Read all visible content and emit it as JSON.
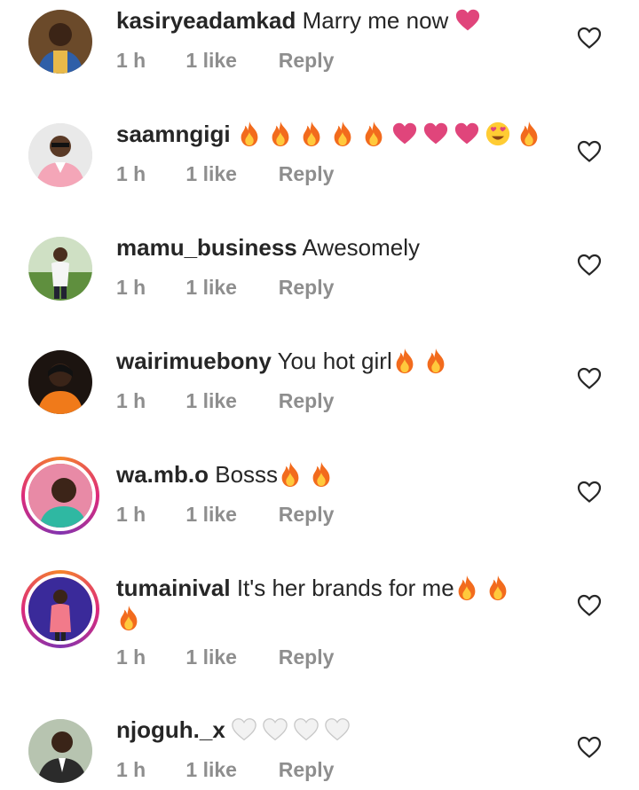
{
  "comments": [
    {
      "username": "kasiryeadamkad",
      "text": "Marry me now",
      "emoji": [
        "heart-pink"
      ],
      "time": "1 h",
      "likes": "1 like",
      "reply": "Reply"
    },
    {
      "username": "saamngigi",
      "text": "",
      "emoji": [
        "fire",
        "fire",
        "fire",
        "fire",
        "fire",
        "heart-pink",
        "heart-pink",
        "heart-pink",
        "heart-eyes",
        "fire"
      ],
      "time": "1 h",
      "likes": "1 like",
      "reply": "Reply"
    },
    {
      "username": "mamu_business",
      "text": "Awesomely",
      "emoji": [],
      "time": "1 h",
      "likes": "1 like",
      "reply": "Reply"
    },
    {
      "username": "wairimuebony",
      "text": "You hot girl",
      "emoji": [
        "fire",
        "fire"
      ],
      "time": "1 h",
      "likes": "1 like",
      "reply": "Reply"
    },
    {
      "username": "wa.mb.o",
      "text": "Bosss",
      "emoji": [
        "fire",
        "fire"
      ],
      "time": "1 h",
      "likes": "1 like",
      "reply": "Reply"
    },
    {
      "username": "tumainival",
      "text": "It's her brands for me",
      "emoji": [
        "fire",
        "fire",
        "fire"
      ],
      "time": "1 h",
      "likes": "1 like",
      "reply": "Reply"
    },
    {
      "username": "njoguh._x",
      "text": "",
      "emoji": [
        "heart-white",
        "heart-white",
        "heart-white",
        "heart-white"
      ],
      "time": "1 h",
      "likes": "1 like",
      "reply": "Reply"
    }
  ],
  "colors": {
    "meta_text": "#8e8e8e",
    "username_text": "#262626",
    "heart_pink": "#e0457b",
    "fire_orange": "#f26b1d"
  },
  "icons": {
    "like": "heart-outline-icon"
  }
}
